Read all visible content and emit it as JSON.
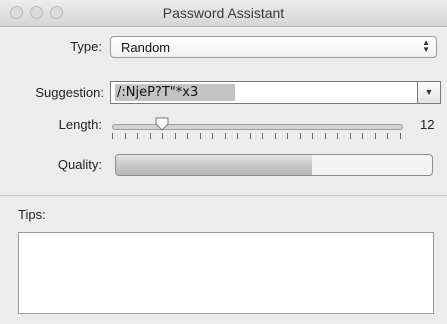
{
  "window": {
    "title": "Password Assistant"
  },
  "type": {
    "label": "Type:",
    "value": "Random"
  },
  "suggestion": {
    "label": "Suggestion:",
    "value": "/:NjeP?T\"*x3"
  },
  "length": {
    "label": "Length:",
    "value": "12",
    "min": 8,
    "max": 31,
    "current": 12,
    "tick_count": 24
  },
  "quality": {
    "label": "Quality:",
    "fraction": 0.62
  },
  "tips": {
    "label": "Tips:",
    "content": ""
  }
}
